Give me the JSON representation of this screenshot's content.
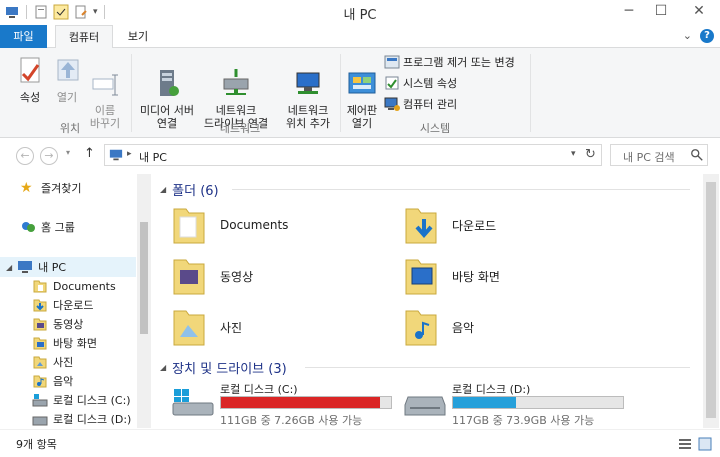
{
  "window": {
    "title": "내 PC"
  },
  "tabs": {
    "file": "파일",
    "computer": "컴퓨터",
    "view": "보기"
  },
  "ribbon": {
    "location": {
      "properties": "속성",
      "open": "열기",
      "rename": "이름\n바꾸기",
      "group": "위치"
    },
    "network": {
      "media_server": "미디어 서버\n연결",
      "map_drive": "네트워크\n드라이브 연결",
      "add_location": "네트워크\n위치 추가",
      "group": "네트워크"
    },
    "system": {
      "control_panel": "제어판\n열기",
      "uninstall": "프로그램 제거 또는 변경",
      "sys_props": "시스템 속성",
      "manage": "컴퓨터 관리",
      "group": "시스템"
    }
  },
  "address": {
    "path": "내 PC",
    "search_placeholder": "내 PC 검색"
  },
  "nav": {
    "favorites": "즐겨찾기",
    "homegroup": "홈 그룹",
    "this_pc": "내 PC",
    "items": [
      "Documents",
      "다운로드",
      "동영상",
      "바탕 화면",
      "사진",
      "음악",
      "로컬 디스크 (C:)",
      "로컬 디스크 (D:)"
    ]
  },
  "content": {
    "folders_header": "폴더 (6)",
    "folders": [
      "Documents",
      "다운로드",
      "동영상",
      "바탕 화면",
      "사진",
      "음악"
    ],
    "drives_header": "장치 및 드라이브 (3)",
    "drives": [
      {
        "name": "로컬 디스크 (C:)",
        "caption": "111GB 중 7.26GB 사용 가능",
        "used_fraction": 0.935,
        "color": "#da2626"
      },
      {
        "name": "로컬 디스크 (D:)",
        "caption": "117GB 중 73.9GB 사용 가능",
        "used_fraction": 0.37,
        "color": "#26a0da"
      }
    ]
  },
  "status": {
    "count": "9개 항목"
  },
  "colors": {
    "accent": "#1979ca",
    "folder": "#f1d77a"
  }
}
